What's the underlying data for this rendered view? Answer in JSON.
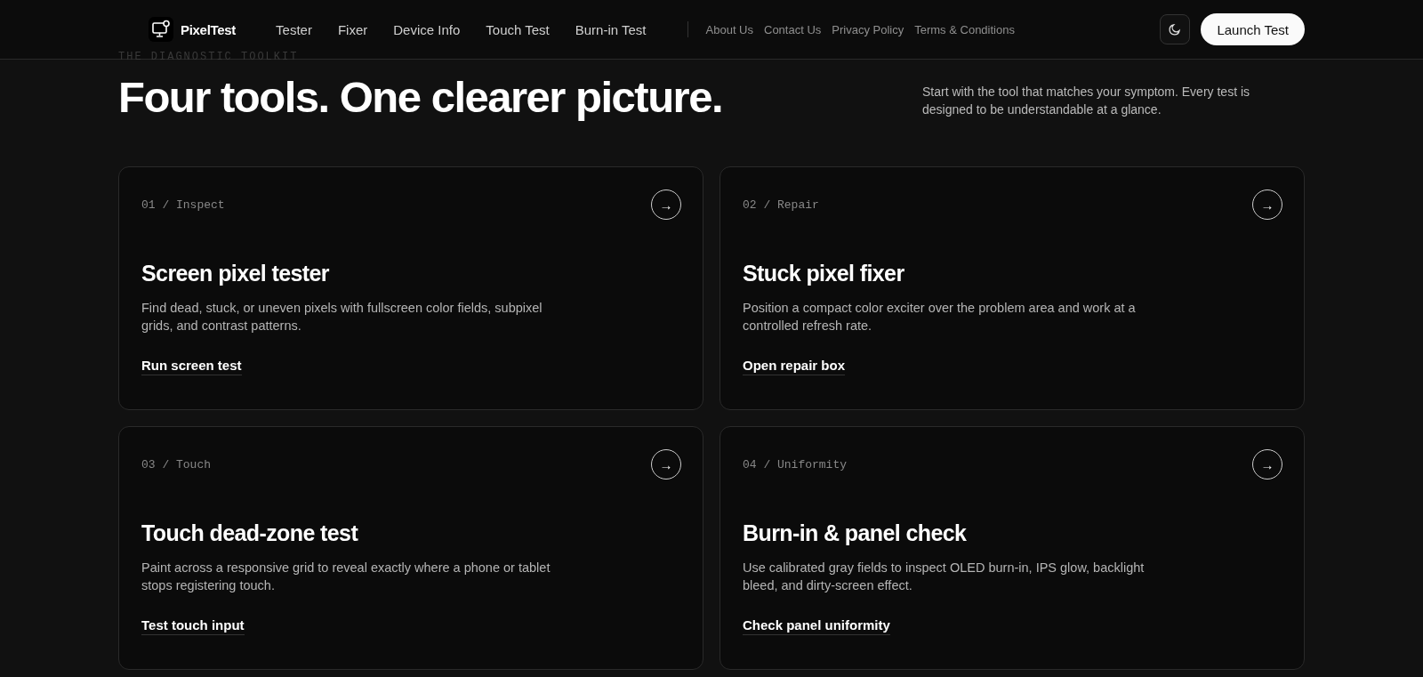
{
  "header": {
    "brand": "PixelTest",
    "nav": [
      {
        "label": "Tester"
      },
      {
        "label": "Fixer"
      },
      {
        "label": "Device Info"
      },
      {
        "label": "Touch Test"
      },
      {
        "label": "Burn-in Test"
      }
    ],
    "secondary_nav": [
      {
        "label": "About Us"
      },
      {
        "label": "Contact Us"
      },
      {
        "label": "Privacy Policy"
      },
      {
        "label": "Terms & Conditions"
      }
    ],
    "launch_button": "Launch Test"
  },
  "intro": {
    "eyebrow": "THE DIAGNOSTIC TOOLKIT",
    "heading": "Four tools. One clearer picture.",
    "description": "Start with the tool that matches your symptom. Every test is designed to be understandable at a glance."
  },
  "tools": [
    {
      "label": "01 / Inspect",
      "arrow": "→",
      "title": "Screen pixel tester",
      "description": "Find dead, stuck, or uneven pixels with fullscreen color fields, subpixel grids, and contrast patterns.",
      "link": "Run screen test"
    },
    {
      "label": "02 / Repair",
      "arrow": "→",
      "title": "Stuck pixel fixer",
      "description": "Position a compact color exciter over the problem area and work at a controlled refresh rate.",
      "link": "Open repair box"
    },
    {
      "label": "03 / Touch",
      "arrow": "→",
      "title": "Touch dead-zone test",
      "description": "Paint across a responsive grid to reveal exactly where a phone or tablet stops registering touch.",
      "link": "Test touch input"
    },
    {
      "label": "04 / Uniformity",
      "arrow": "→",
      "title": "Burn-in & panel check",
      "description": "Use calibrated gray fields to inspect OLED burn-in, IPS glow, backlight bleed, and dirty-screen effect.",
      "link": "Check panel uniformity"
    }
  ]
}
